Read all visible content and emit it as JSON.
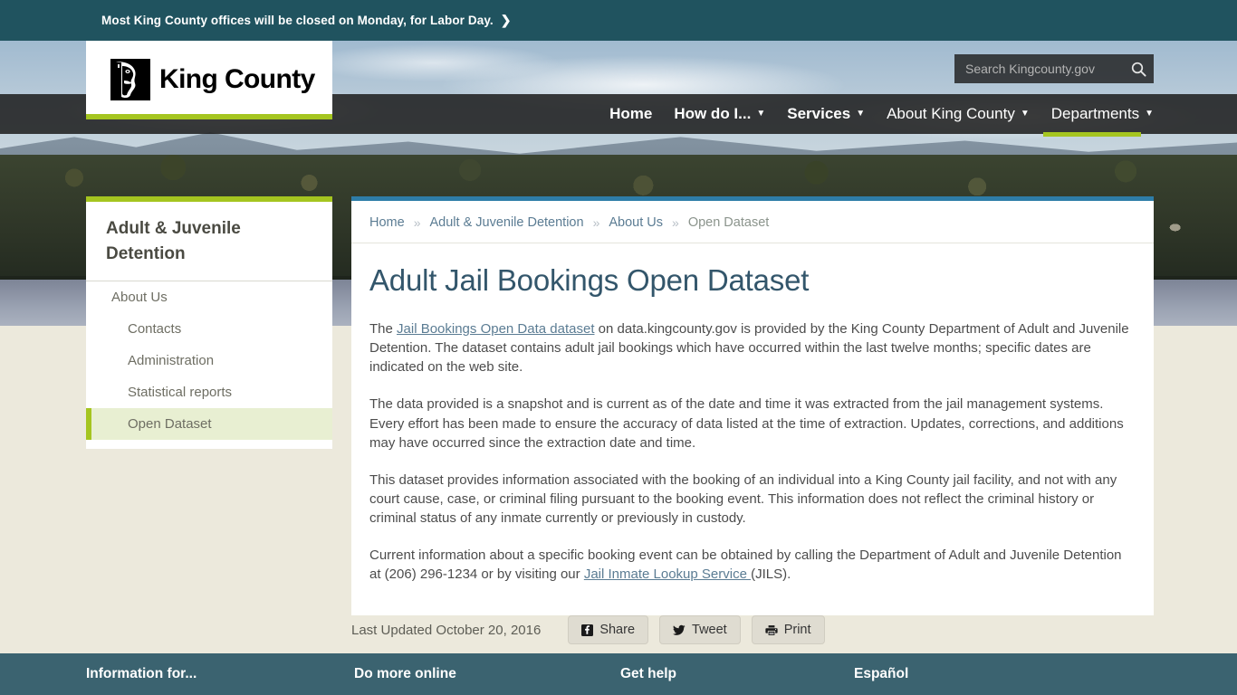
{
  "alert": {
    "text": "Most King County offices will be closed on Monday, for Labor Day.",
    "chevron": "❯"
  },
  "logo": {
    "wordmark": "King County",
    "mark_name": "king-county-mlk-silhouette"
  },
  "search": {
    "placeholder": "Search Kingcounty.gov",
    "value": "",
    "icon": "search-icon"
  },
  "nav": {
    "items": [
      {
        "label": "Home",
        "bold": true,
        "caret": ""
      },
      {
        "label": "How do I...",
        "bold": true,
        "caret": "▼"
      },
      {
        "label": "Services",
        "bold": true,
        "caret": "▼"
      },
      {
        "label": "About King County",
        "bold": false,
        "caret": "▼"
      },
      {
        "label": "Departments",
        "bold": false,
        "caret": "▼"
      }
    ],
    "active": "Departments"
  },
  "sidebar": {
    "title": "Adult & Juvenile Detention",
    "items": [
      {
        "label": "About Us",
        "sub": false,
        "active": false
      },
      {
        "label": "Contacts",
        "sub": true,
        "active": false
      },
      {
        "label": "Administration",
        "sub": true,
        "active": false
      },
      {
        "label": "Statistical reports",
        "sub": true,
        "active": false
      },
      {
        "label": "Open Dataset",
        "sub": true,
        "active": true
      }
    ]
  },
  "breadcrumb": {
    "separator": "»",
    "items": [
      {
        "label": "Home",
        "current": false
      },
      {
        "label": "Adult & Juvenile Detention",
        "current": false
      },
      {
        "label": "About Us",
        "current": false
      },
      {
        "label": "Open Dataset",
        "current": true
      }
    ]
  },
  "main": {
    "title": "Adult Jail Bookings Open Dataset",
    "paragraph1": {
      "lead": "The ",
      "link": "Jail Bookings Open Data dataset",
      "rest": " on data.kingcounty.gov is provided by the King County Department of Adult and Juvenile Detention. The dataset contains adult jail bookings which have occurred within the last twelve months; specific dates are indicated on the web site."
    },
    "paragraph2": "The data provided is a snapshot and is current as of the date and time it was extracted from the jail management systems. Every effort has been made to ensure the accuracy of data listed at the time of extraction. Updates, corrections, and additions may have occurred since the extraction date and time.",
    "paragraph3": "This dataset provides information associated with the booking of an individual into a King County jail facility, and not with any court cause, case, or criminal filing pursuant to the booking event. This information does not reflect the criminal history or criminal status of any inmate currently or previously in custody.",
    "paragraph4": {
      "lead": "Current information about a specific booking event can be obtained by calling the Department of Adult and Juvenile Detention at (206) 296-1234 or by visiting our ",
      "link": "Jail Inmate Lookup Service ",
      "rest": "(JILS)."
    }
  },
  "meta": {
    "last_updated": "Last Updated October 20, 2016",
    "share_label": "Share",
    "tweet_label": "Tweet",
    "print_label": "Print"
  },
  "footer": {
    "columns": [
      "Information for...",
      "Do more online",
      "Get help",
      "Español"
    ]
  },
  "colors": {
    "alert_bar": "#20535f",
    "brand_green": "#a5c520",
    "footer_teal": "#3b6370",
    "card_top_border": "#2e7da8",
    "title_blue": "#33566b",
    "link_blue": "#5b7c93",
    "page_bg": "#ece9dc",
    "active_nav_bg": "#e8efd2"
  }
}
